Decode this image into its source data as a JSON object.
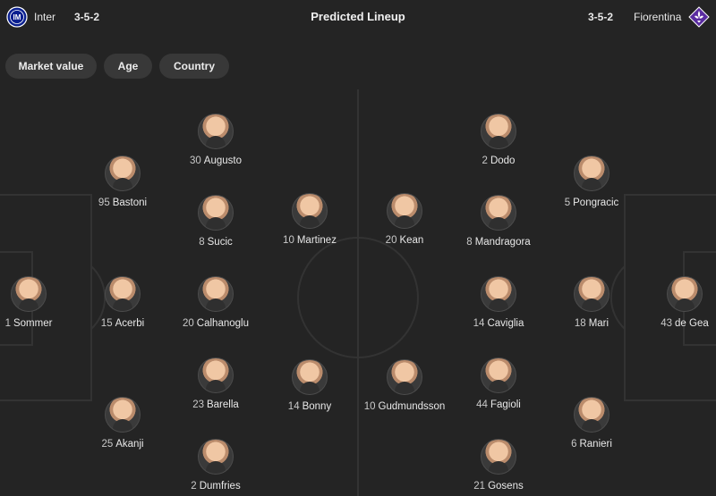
{
  "title": "Predicted Lineup",
  "home": {
    "name": "Inter",
    "formation": "3-5-2",
    "logo": "inter-crest-icon",
    "color": "#0a1f8f"
  },
  "away": {
    "name": "Fiorentina",
    "formation": "3-5-2",
    "logo": "fiorentina-lily-icon",
    "color": "#5a2ca0"
  },
  "filters": [
    "Market value",
    "Age",
    "Country"
  ],
  "home_players": [
    {
      "number": "1",
      "name": "Sommer"
    },
    {
      "number": "95",
      "name": "Bastoni"
    },
    {
      "number": "15",
      "name": "Acerbi"
    },
    {
      "number": "25",
      "name": "Akanji"
    },
    {
      "number": "30",
      "name": "Augusto"
    },
    {
      "number": "8",
      "name": "Sucic"
    },
    {
      "number": "20",
      "name": "Calhanoglu"
    },
    {
      "number": "23",
      "name": "Barella"
    },
    {
      "number": "2",
      "name": "Dumfries"
    },
    {
      "number": "10",
      "name": "Martinez"
    },
    {
      "number": "14",
      "name": "Bonny"
    }
  ],
  "away_players": [
    {
      "number": "43",
      "name": "de Gea"
    },
    {
      "number": "5",
      "name": "Pongracic"
    },
    {
      "number": "18",
      "name": "Mari"
    },
    {
      "number": "6",
      "name": "Ranieri"
    },
    {
      "number": "2",
      "name": "Dodo"
    },
    {
      "number": "8",
      "name": "Mandragora"
    },
    {
      "number": "14",
      "name": "Caviglia"
    },
    {
      "number": "44",
      "name": "Fagioli"
    },
    {
      "number": "21",
      "name": "Gosens"
    },
    {
      "number": "20",
      "name": "Kean"
    },
    {
      "number": "10",
      "name": "Gudmundsson"
    }
  ]
}
